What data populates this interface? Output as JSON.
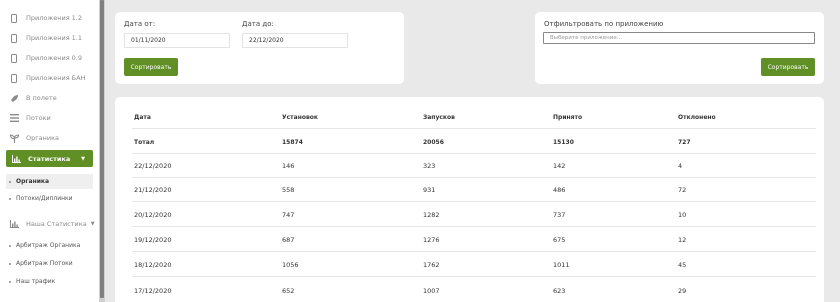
{
  "sidebar": {
    "items": [
      {
        "label": "Приложения 1.2",
        "icon": "phone-icon"
      },
      {
        "label": "Приложения 1.1",
        "icon": "phone-icon"
      },
      {
        "label": "Приложения 0.9",
        "icon": "phone-icon"
      },
      {
        "label": "Приложения БАН",
        "icon": "phone-icon"
      },
      {
        "label": "В полете",
        "icon": "rocket-icon"
      },
      {
        "label": "Потоки",
        "icon": "list-icon"
      },
      {
        "label": "Органика",
        "icon": "sprout-icon"
      }
    ],
    "active": {
      "label": "Статистика",
      "icon": "bar-chart-icon"
    },
    "sub_items": [
      {
        "label": "Органика"
      },
      {
        "label": "Потоки/Диплинки"
      }
    ],
    "group": {
      "label": "Наша Статистика",
      "icon": "bar-chart-icon"
    },
    "group_items": [
      {
        "label": "Арбитраж Органика"
      },
      {
        "label": "Арбитраж Потоки"
      },
      {
        "label": "Наш трафик"
      }
    ]
  },
  "filters": {
    "date_from_label": "Дата от:",
    "date_from_value": "01/11/2020",
    "date_to_label": "Дата до:",
    "date_to_value": "22/12/2020",
    "sort_button": "Сортировать",
    "app_filter_label": "Отфильтровать по приложению",
    "app_filter_placeholder": "Выберите приложение...",
    "app_sort_button": "Сортировать"
  },
  "table": {
    "headers": [
      "Дата",
      "Установок",
      "Запусков",
      "Принято",
      "Отклонено"
    ],
    "rows": [
      [
        "Тотал",
        "15874",
        "20056",
        "15130",
        "727"
      ],
      [
        "22/12/2020",
        "146",
        "323",
        "142",
        "4"
      ],
      [
        "21/12/2020",
        "558",
        "931",
        "486",
        "72"
      ],
      [
        "20/12/2020",
        "747",
        "1282",
        "737",
        "10"
      ],
      [
        "19/12/2020",
        "687",
        "1276",
        "675",
        "12"
      ],
      [
        "18/12/2020",
        "1056",
        "1762",
        "1011",
        "45"
      ],
      [
        "17/12/2020",
        "652",
        "1007",
        "623",
        "29"
      ]
    ]
  }
}
